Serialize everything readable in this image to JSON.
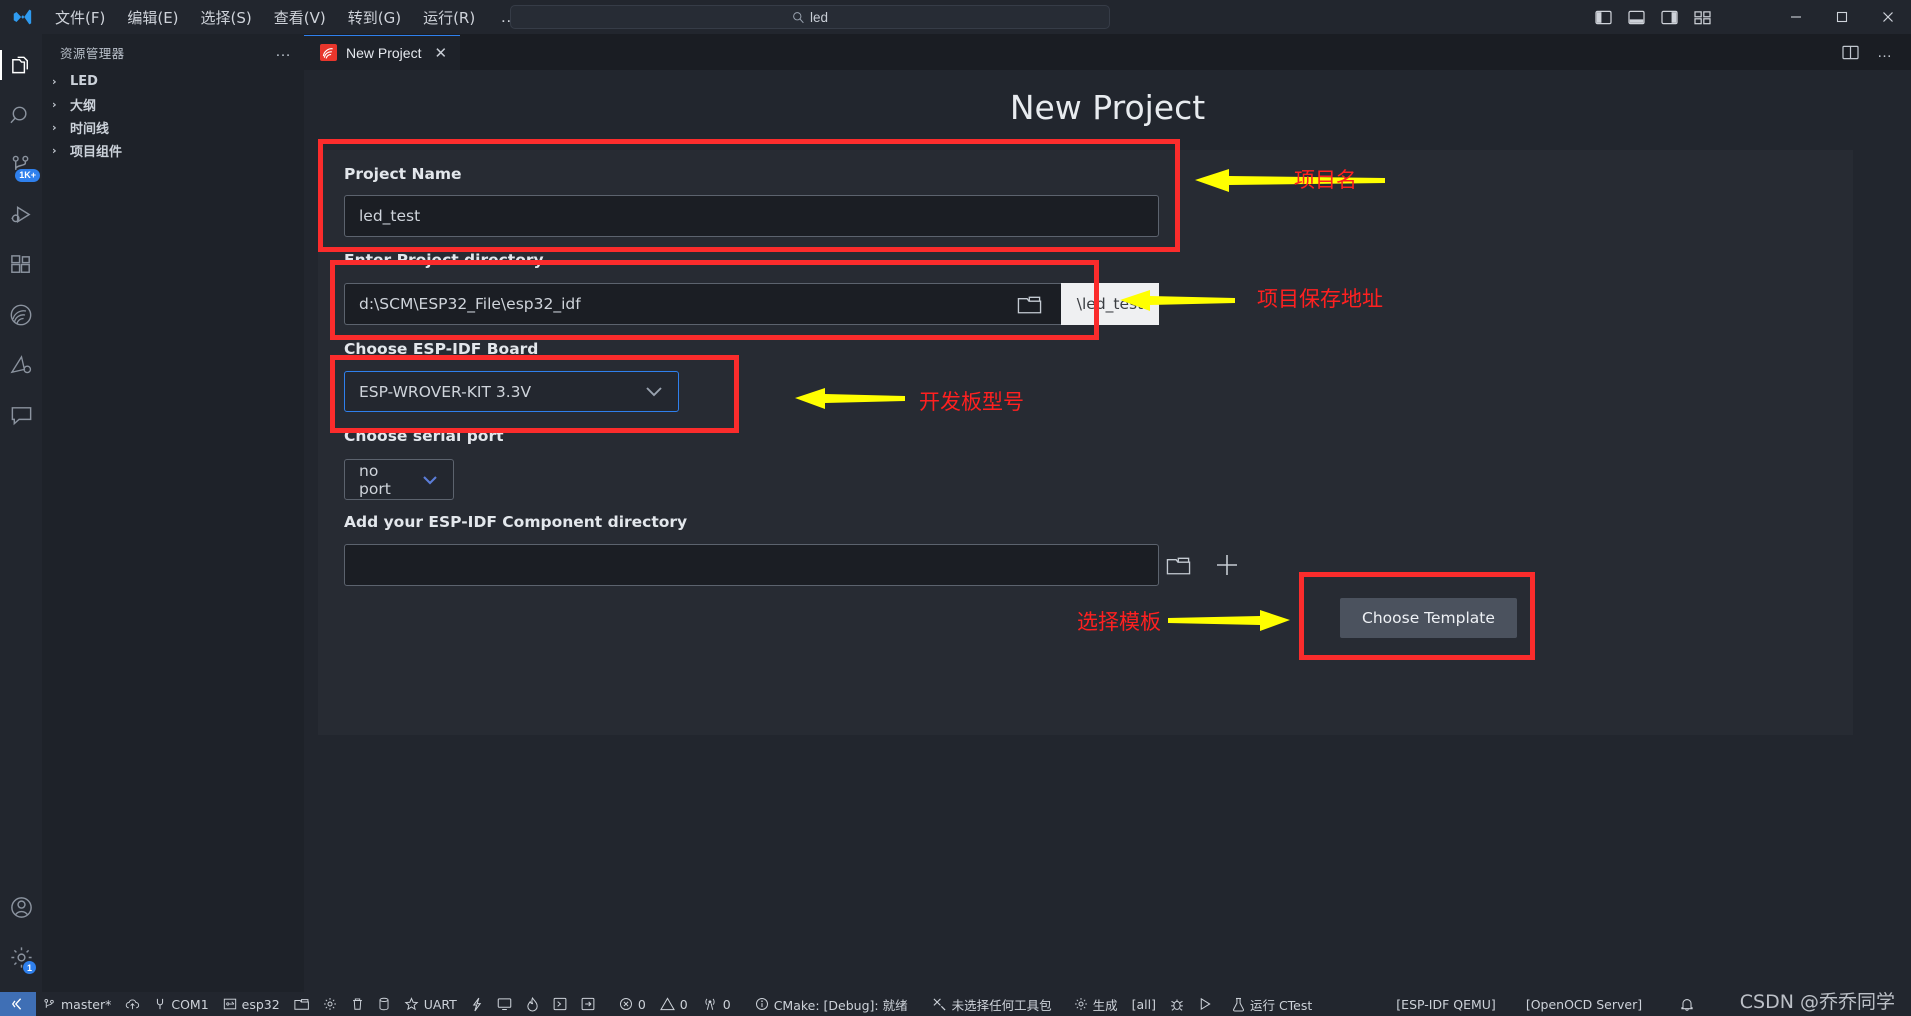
{
  "titlebar": {
    "menu": [
      "文件(F)",
      "编辑(E)",
      "选择(S)",
      "查看(V)",
      "转到(G)",
      "运行(R)"
    ],
    "overflow": "…",
    "back_icon": "←",
    "forward_icon": "→",
    "search": {
      "icon": "search-icon",
      "value": "led"
    },
    "window_controls": {
      "minimize": "─",
      "maximize": "☐",
      "close": "✕"
    }
  },
  "activitybar": {
    "items": [
      {
        "name": "explorer",
        "icon": "files-icon",
        "badge": ""
      },
      {
        "name": "search",
        "icon": "search-icon",
        "badge": ""
      },
      {
        "name": "source-control",
        "icon": "source-control-icon",
        "badge": "1K+"
      },
      {
        "name": "run-and-debug",
        "icon": "run-debug-icon",
        "badge": ""
      },
      {
        "name": "extensions",
        "icon": "extensions-icon",
        "badge": ""
      },
      {
        "name": "espressif-idf",
        "icon": "espressif-icon",
        "badge": ""
      },
      {
        "name": "platformio",
        "icon": "platformio-icon",
        "badge": ""
      },
      {
        "name": "comments",
        "icon": "comment-icon",
        "badge": ""
      }
    ],
    "bottom": [
      {
        "name": "accounts",
        "icon": "account-icon",
        "badge": ""
      },
      {
        "name": "settings",
        "icon": "gear-icon",
        "badge": "1"
      }
    ]
  },
  "sidebar": {
    "title": "资源管理器",
    "more_icon": "…",
    "tree": [
      {
        "label": "LED",
        "chevron": "›"
      },
      {
        "label": "大纲",
        "chevron": "›"
      },
      {
        "label": "时间线",
        "chevron": "›"
      },
      {
        "label": "项目组件",
        "chevron": "›"
      }
    ]
  },
  "tabs": {
    "active": {
      "label": "New Project",
      "icon": "espressif-icon",
      "close": "✕"
    },
    "actions": [
      {
        "name": "split-editor",
        "icon": "split-editor-icon"
      },
      {
        "name": "more-actions",
        "icon": "ellipsis-icon",
        "glyph": "…"
      }
    ]
  },
  "page": {
    "title": "New Project",
    "fields": {
      "project_name": {
        "label": "Project Name",
        "value": "led_test",
        "placeholder": "Project Name"
      },
      "project_directory": {
        "label": "Enter Project directory",
        "value": "d:\\SCM\\ESP32_File\\esp32_idf",
        "suffix": "\\led_test",
        "browse_icon": "folder-icon"
      },
      "board": {
        "label": "Choose ESP-IDF Board",
        "value": "ESP-WROVER-KIT 3.3V",
        "chevron": "⌄"
      },
      "serial_port": {
        "label": "Choose serial port",
        "value": "no port",
        "chevron": "⌄"
      },
      "component_directory": {
        "label": "Add your ESP-IDF Component directory",
        "value": "",
        "placeholder": "",
        "browse_icon": "folder-icon",
        "add_icon": "plus-icon"
      }
    },
    "choose_template_button": "Choose Template"
  },
  "annotations": [
    {
      "name": "project-name-note",
      "text": "项目名"
    },
    {
      "name": "project-path-note",
      "text": "项目保存地址"
    },
    {
      "name": "board-model-note",
      "text": "开发板型号"
    },
    {
      "name": "choose-template-note",
      "text": "选择模板"
    }
  ],
  "statusbar": {
    "remote_icon": "remote-icon",
    "left": [
      {
        "name": "git-branch",
        "icon": "branch-icon",
        "label": "master*"
      },
      {
        "name": "git-sync",
        "icon": "cloud-upload-icon",
        "label": ""
      },
      {
        "name": "serial-port",
        "icon": "plug-icon",
        "label": "COM1"
      },
      {
        "name": "idf-target",
        "icon": "chip-icon",
        "label": "esp32"
      },
      {
        "name": "open-folder",
        "icon": "folder-icon",
        "label": ""
      },
      {
        "name": "sdk-configuration",
        "icon": "gear-icon",
        "label": ""
      },
      {
        "name": "full-clean",
        "icon": "trash-icon",
        "label": ""
      },
      {
        "name": "erase-flash",
        "icon": "database-icon",
        "label": ""
      },
      {
        "name": "flash-method",
        "icon": "star-icon",
        "label": "UART"
      },
      {
        "name": "build-flash-monitor",
        "icon": "flame-bolt-icon",
        "label": ""
      },
      {
        "name": "monitor-device",
        "icon": "monitor-icon",
        "label": ""
      },
      {
        "name": "flash-device",
        "icon": "flame-icon",
        "label": ""
      },
      {
        "name": "open-terminal",
        "icon": "terminal-icon",
        "label": ""
      },
      {
        "name": "idf-terminal",
        "icon": "arrow-box-icon",
        "label": ""
      },
      {
        "name": "problems-errors",
        "icon": "error-icon",
        "label": "0"
      },
      {
        "name": "problems-warnings",
        "icon": "warning-icon",
        "label": "0"
      },
      {
        "name": "radio-ports",
        "icon": "radio-tower-icon",
        "label": "0"
      },
      {
        "name": "cmake-status",
        "icon": "info-icon",
        "label": "CMake: [Debug]: 就绪"
      },
      {
        "name": "cmake-kit",
        "icon": "tools-icon",
        "label": "未选择任何工具包"
      },
      {
        "name": "cmake-build",
        "icon": "gear-icon",
        "label": "生成"
      },
      {
        "name": "cmake-build-target",
        "icon": "",
        "label": "[all]"
      },
      {
        "name": "cmake-debug",
        "icon": "bug-icon",
        "label": ""
      },
      {
        "name": "cmake-launch",
        "icon": "play-icon",
        "label": ""
      },
      {
        "name": "run-ctest",
        "icon": "beaker-icon",
        "label": "运行 CTest"
      },
      {
        "name": "esp-idf-qemu",
        "icon": "",
        "label": "[ESP-IDF QEMU]"
      },
      {
        "name": "openocd-server",
        "icon": "",
        "label": "[OpenOCD Server]"
      },
      {
        "name": "notifications",
        "icon": "bell-icon",
        "label": ""
      }
    ]
  },
  "watermark": "CSDN @乔乔同学"
}
